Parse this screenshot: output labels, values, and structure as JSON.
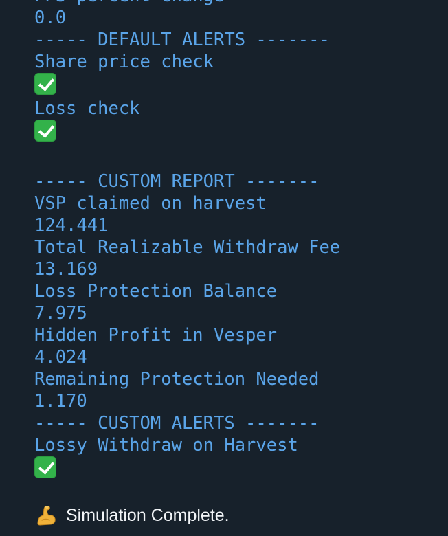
{
  "lines": {
    "pps_percent_change_label": "PPS percent change",
    "pps_percent_change_value": "0.0",
    "default_alerts_header": "----- DEFAULT ALERTS -------",
    "share_price_check": "Share price check",
    "loss_check": "Loss check",
    "custom_report_header": "----- CUSTOM REPORT -------",
    "vsp_claimed_label": "VSP claimed on harvest",
    "vsp_claimed_value": "124.441",
    "withdraw_fee_label": "Total Realizable Withdraw Fee",
    "withdraw_fee_value": "13.169",
    "loss_protection_label": "Loss Protection Balance",
    "loss_protection_value": "7.975",
    "hidden_profit_label": "Hidden Profit in Vesper",
    "hidden_profit_value": "4.024",
    "remaining_protection_label": "Remaining Protection Needed",
    "remaining_protection_value": "1.170",
    "custom_alerts_header": "----- CUSTOM ALERTS -------",
    "lossy_withdraw_label": "Lossy Withdraw on Harvest"
  },
  "final_message": "Simulation Complete.",
  "icons": {
    "check": "white-heavy-check-mark-icon",
    "bicep": "flexed-biceps-icon"
  },
  "colors": {
    "background": "#17212b",
    "mono_text": "#5aa4e8",
    "final_text": "#f2f5f8",
    "check_green": "#33b24a"
  }
}
